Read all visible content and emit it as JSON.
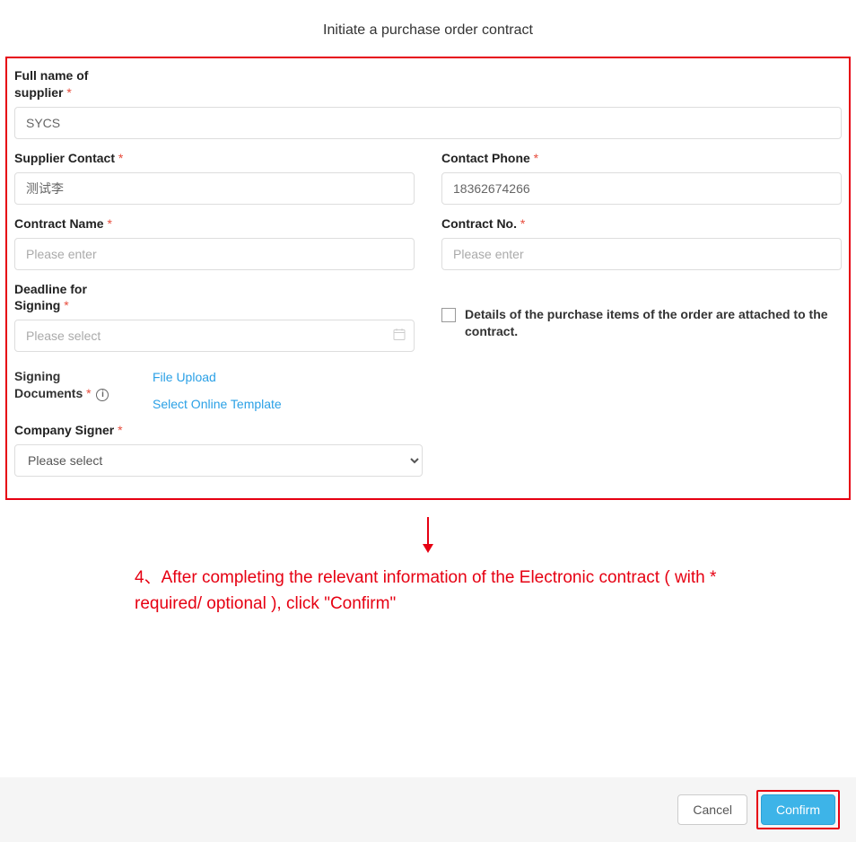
{
  "title": "Initiate a purchase order contract",
  "form": {
    "supplier_name": {
      "label": "Full name of supplier",
      "value": "SYCS"
    },
    "supplier_contact": {
      "label": "Supplier Contact",
      "value": "测试李"
    },
    "contact_phone": {
      "label": "Contact Phone",
      "value": "18362674266"
    },
    "contract_name": {
      "label": "Contract Name",
      "placeholder": "Please enter",
      "value": ""
    },
    "contract_no": {
      "label": "Contract No.",
      "placeholder": "Please enter",
      "value": ""
    },
    "deadline": {
      "label": "Deadline for Signing",
      "placeholder": "Please select",
      "value": ""
    },
    "attach_items": {
      "label": "Details of the purchase items of the order are attached to the contract.",
      "checked": false
    },
    "signing_docs": {
      "label": "Signing Documents",
      "file_upload": "File Upload",
      "online_template": "Select Online Template"
    },
    "company_signer": {
      "label": "Company Signer",
      "placeholder": "Please select",
      "value": ""
    }
  },
  "annotation": "4、After completing the relevant information of the Electronic contract ( with * required/ optional ), click \"Confirm\"",
  "footer": {
    "cancel": "Cancel",
    "confirm": "Confirm"
  }
}
